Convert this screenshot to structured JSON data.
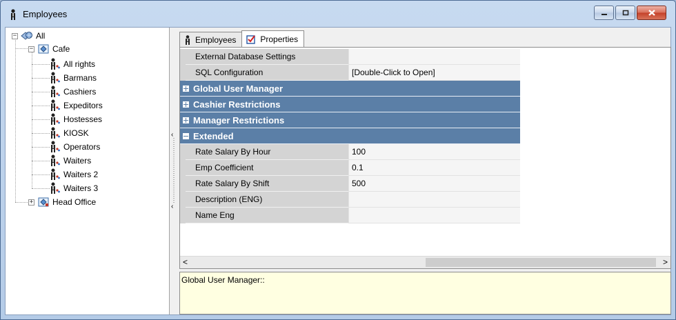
{
  "window": {
    "title": "Employees"
  },
  "tree": {
    "root": {
      "label": "All"
    },
    "group1": {
      "label": "Cafe",
      "children": [
        "All rights",
        "Barmans",
        "Cashiers",
        "Expeditors",
        "Hostesses",
        "KIOSK",
        "Operators",
        "Waiters",
        "Waiters 2",
        "Waiters 3"
      ]
    },
    "group2": {
      "label": "Head Office"
    }
  },
  "tabs": [
    {
      "label": "Employees",
      "icon": "person-icon"
    },
    {
      "label": "Properties",
      "icon": "properties-icon",
      "selected": true
    }
  ],
  "grid": {
    "rows": [
      {
        "kind": "prop",
        "name": "External Database Settings",
        "value": ""
      },
      {
        "kind": "prop",
        "name": "SQL Configuration",
        "value": "[Double-Click to Open]"
      },
      {
        "kind": "cat",
        "name": "Global User Manager",
        "expanded": false
      },
      {
        "kind": "cat",
        "name": "Cashier Restrictions",
        "expanded": false
      },
      {
        "kind": "cat",
        "name": "Manager Restrictions",
        "expanded": false
      },
      {
        "kind": "cat",
        "name": "Extended",
        "expanded": true
      },
      {
        "kind": "prop",
        "name": "Rate Salary By Hour",
        "value": "100"
      },
      {
        "kind": "prop",
        "name": "Emp Coefficient",
        "value": "0.1"
      },
      {
        "kind": "prop",
        "name": "Rate Salary By Shift",
        "value": "500"
      },
      {
        "kind": "prop",
        "name": "Description (ENG)",
        "value": ""
      },
      {
        "kind": "prop",
        "name": "Name Eng",
        "value": ""
      }
    ]
  },
  "description": {
    "text": "Global User Manager::"
  },
  "colors": {
    "category": "#5b7fa7",
    "description_bg": "#ffffe1",
    "title_bar": "#c7daf0"
  }
}
